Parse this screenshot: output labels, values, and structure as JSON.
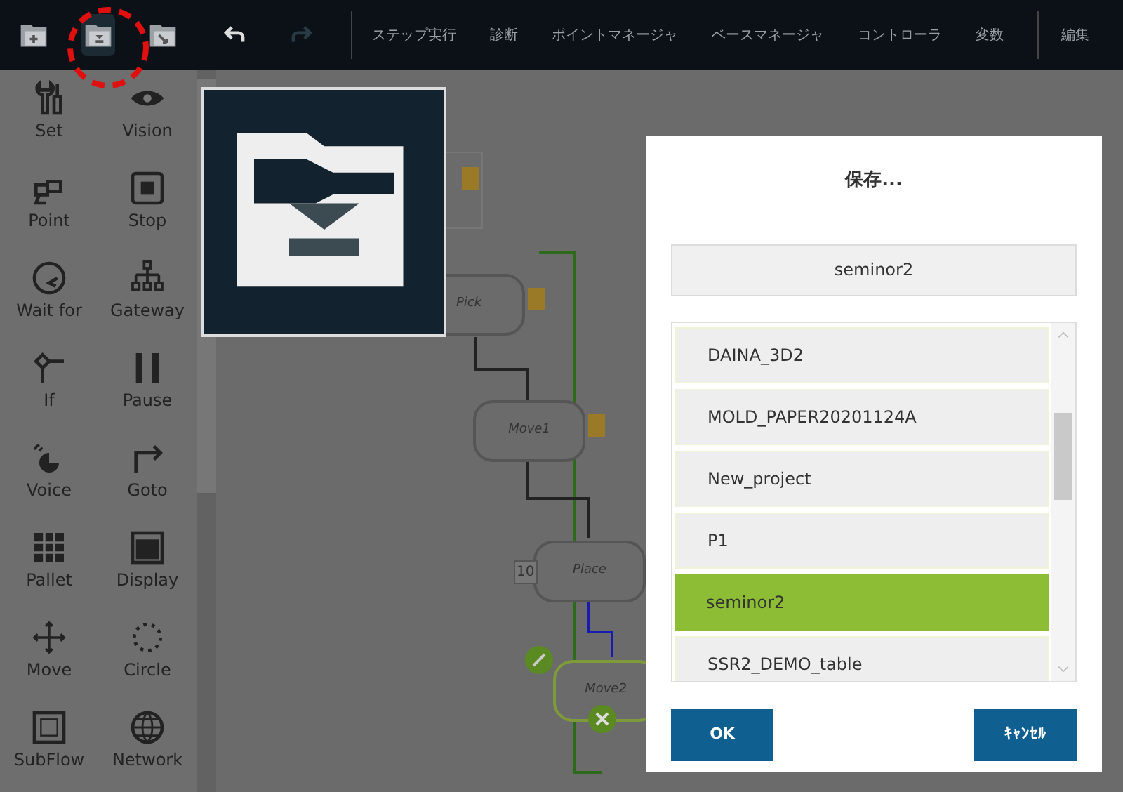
{
  "toolbar": {
    "file_buttons": [
      {
        "selected": false
      },
      {
        "selected": true
      },
      {
        "selected": false
      }
    ],
    "menu": [
      "ステップ実行",
      "診断",
      "ポイントマネージャ",
      "ベースマネージャ",
      "コントローラ",
      "変数",
      "編集"
    ]
  },
  "palette": [
    {
      "label": "Set"
    },
    {
      "label": "Vision"
    },
    {
      "label": "Point"
    },
    {
      "label": "Stop"
    },
    {
      "label": "Wait for"
    },
    {
      "label": "Gateway"
    },
    {
      "label": "If"
    },
    {
      "label": "Pause"
    },
    {
      "label": "Voice"
    },
    {
      "label": "Goto"
    },
    {
      "label": "Pallet"
    },
    {
      "label": "Display"
    },
    {
      "label": "Move"
    },
    {
      "label": "Circle"
    },
    {
      "label": "SubFlow"
    },
    {
      "label": "Network"
    }
  ],
  "flow": {
    "nodes": [
      {
        "label": "Pick",
        "selected": false
      },
      {
        "label": "Move1",
        "selected": false
      },
      {
        "label": "Place",
        "tag": "10",
        "selected": false
      },
      {
        "label": "Move2",
        "selected": true
      }
    ]
  },
  "dialog": {
    "title": "保存...",
    "name_field": {
      "value": "seminor2"
    },
    "items": [
      {
        "label": "DAINA_3D2",
        "selected": false
      },
      {
        "label": "MOLD_PAPER20201124A",
        "selected": false
      },
      {
        "label": "New_project",
        "selected": false
      },
      {
        "label": "P1",
        "selected": false
      },
      {
        "label": "seminor2",
        "selected": true
      },
      {
        "label": "SSR2_DEMO_table",
        "selected": false
      }
    ],
    "buttons": [
      "OK",
      "ｷｬﾝｾﾙ"
    ]
  }
}
